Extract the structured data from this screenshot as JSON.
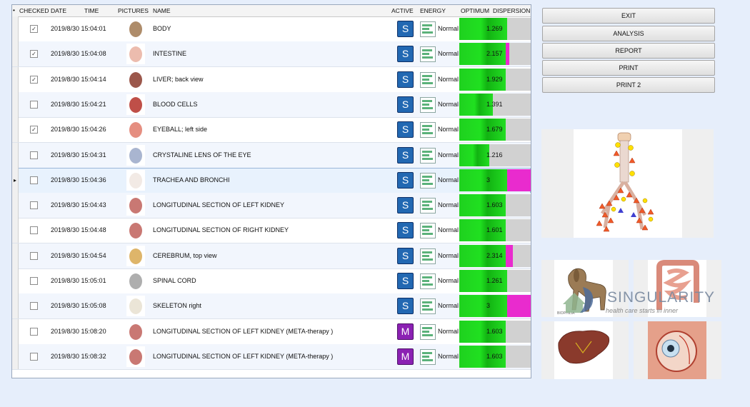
{
  "grid": {
    "headers": {
      "checked": "CHECKED",
      "date": "DATE",
      "time": "TIME",
      "pictures": "PICTURES",
      "name": "NAME",
      "active": "ACTIVE",
      "energy": "ENERGY",
      "optimum": "OPTIMUM",
      "dispersion": "DISPERSION"
    },
    "rows": [
      {
        "checked": true,
        "datetime": "2019/8/30 15:04:01",
        "name": "BODY",
        "active": "S",
        "energy": "Normal",
        "dispersion": "1.269",
        "level": 0.67,
        "extra": 0
      },
      {
        "checked": true,
        "datetime": "2019/8/30 15:04:08",
        "name": "INTESTINE",
        "active": "S",
        "energy": "Normal",
        "dispersion": "2.157",
        "level": 0.65,
        "extra": 0.05
      },
      {
        "checked": true,
        "datetime": "2019/8/30 15:04:14",
        "name": "LIVER; back view",
        "active": "S",
        "energy": "Normal",
        "dispersion": "1.929",
        "level": 0.65,
        "extra": 0
      },
      {
        "checked": false,
        "datetime": "2019/8/30 15:04:21",
        "name": "BLOOD   CELLS",
        "active": "S",
        "energy": "Normal",
        "dispersion": "1.391",
        "level": 0.47,
        "extra": 0
      },
      {
        "checked": true,
        "datetime": "2019/8/30 15:04:26",
        "name": "EYEBALL;  left  side",
        "active": "S",
        "energy": "Normal",
        "dispersion": "1.679",
        "level": 0.65,
        "extra": 0
      },
      {
        "checked": false,
        "datetime": "2019/8/30 15:04:31",
        "name": "CRYSTALINE LENS OF THE EYE",
        "active": "S",
        "energy": "Normal",
        "dispersion": "1.216",
        "level": 0.42,
        "extra": 0
      },
      {
        "checked": false,
        "datetime": "2019/8/30 15:04:36",
        "name": "TRACHEA   AND   BRONCHI",
        "active": "S",
        "energy": "Normal",
        "dispersion": "3",
        "level": 0.67,
        "extra": 0.33,
        "selected": true
      },
      {
        "checked": false,
        "datetime": "2019/8/30 15:04:43",
        "name": "LONGITUDINAL   SECTION   OF   LEFT  KIDNEY",
        "active": "S",
        "energy": "Normal",
        "dispersion": "1.603",
        "level": 0.65,
        "extra": 0
      },
      {
        "checked": false,
        "datetime": "2019/8/30 15:04:48",
        "name": "LONGITUDINAL   SECTION   OF   RIGHT   KIDNEY",
        "active": "S",
        "energy": "Normal",
        "dispersion": "1.601",
        "level": 0.65,
        "extra": 0
      },
      {
        "checked": false,
        "datetime": "2019/8/30 15:04:54",
        "name": "CEREBRUM, top view",
        "active": "S",
        "energy": "Normal",
        "dispersion": "2.314",
        "level": 0.65,
        "extra": 0.1
      },
      {
        "checked": false,
        "datetime": "2019/8/30 15:05:01",
        "name": "SPINAL CORD",
        "active": "S",
        "energy": "Normal",
        "dispersion": "1.261",
        "level": 0.67,
        "extra": 0
      },
      {
        "checked": false,
        "datetime": "2019/8/30 15:05:08",
        "name": "SKELETON right",
        "active": "S",
        "energy": "Normal",
        "dispersion": "3",
        "level": 0.67,
        "extra": 0.33
      },
      {
        "checked": false,
        "datetime": "2019/8/30 15:08:20",
        "name": "LONGITUDINAL   SECTION   OF   LEFT  KIDNEY (META-therapy )",
        "active": "M",
        "energy": "Normal",
        "dispersion": "1.603",
        "level": 0.65,
        "extra": 0
      },
      {
        "checked": false,
        "datetime": "2019/8/30 15:08:32",
        "name": "LONGITUDINAL   SECTION   OF   LEFT  KIDNEY (META-therapy )",
        "active": "M",
        "energy": "Normal",
        "dispersion": "1.603",
        "level": 0.65,
        "extra": 0
      }
    ]
  },
  "buttons": {
    "exit": "EXIT",
    "analysis": "ANALYSIS",
    "report": "REPORT",
    "print": "PRINT",
    "print2": "PRINT 2"
  },
  "watermark": {
    "brand": "SINGULARITY",
    "tagline": "health care starts in inner",
    "logo_text": "BIOPHILIA"
  },
  "colors": {
    "active_s": "#2268b2",
    "active_m": "#8b21b3",
    "bar_green": "#20e020",
    "bar_pink": "#e92bce",
    "bar_bg": "#d1d1d1"
  }
}
